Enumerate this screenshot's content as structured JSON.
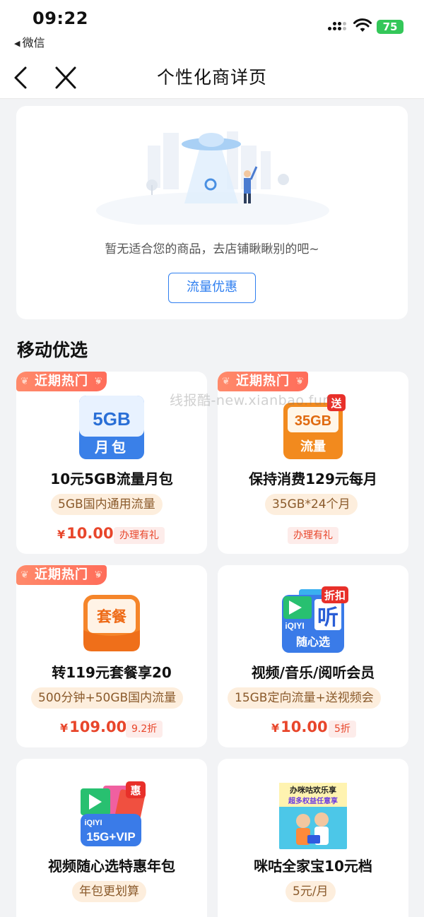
{
  "status_bar": {
    "time": "09:22",
    "back_app": "微信",
    "battery": "75"
  },
  "navbar": {
    "title": "个性化商详页"
  },
  "empty_state": {
    "message": "暂无适合您的商品，去店铺瞅瞅别的吧~",
    "button": "流量优惠"
  },
  "section": {
    "title": "移动优选"
  },
  "watermark": "线报酷-new.xianbao.fun",
  "products": [
    {
      "hot": "近期热门",
      "icon_text": "5GB",
      "icon_sub": "月包",
      "name": "10元5GB流量月包",
      "tag": "5GB国内通用流量",
      "price": "10.00",
      "badge": "办理有礼"
    },
    {
      "hot": "近期热门",
      "icon_text": "35GB",
      "icon_sub": "流量",
      "icon_corner": "送",
      "name": "保持消费129元每月",
      "tag": "35GB*24个月",
      "price": "",
      "badge": "办理有礼"
    },
    {
      "hot": "近期热门",
      "icon_text": "套餐",
      "name": "转119元套餐享20",
      "tag": "500分钟+50GB国内流量",
      "price": "109.00",
      "badge": "9.2折"
    },
    {
      "hot": "",
      "icon_text": "随心选",
      "icon_corner": "折扣",
      "icon_mid": "iQIYI",
      "icon_listen": "听",
      "name": "视频/音乐/阅听会员",
      "tag": "15GB定向流量+送视频会",
      "price": "10.00",
      "badge": "5折"
    },
    {
      "hot": "",
      "icon_text": "15G+VIP",
      "icon_corner": "惠",
      "icon_mid": "iQIYI",
      "name": "视频随心选特惠年包",
      "tag": "年包更划算",
      "price": "",
      "badge": ""
    },
    {
      "hot": "",
      "icon_text": "办咪咕欢乐享",
      "icon_sub": "超多权益任意享",
      "name": "咪咕全家宝10元档",
      "tag": "5元/月",
      "price": "",
      "badge": ""
    }
  ],
  "yen": "¥",
  "colors": {
    "accent": "#2f7ff0",
    "price": "#e8462b",
    "hot_tag": "#ff7a5e",
    "tag_bg": "#fdeedd"
  }
}
